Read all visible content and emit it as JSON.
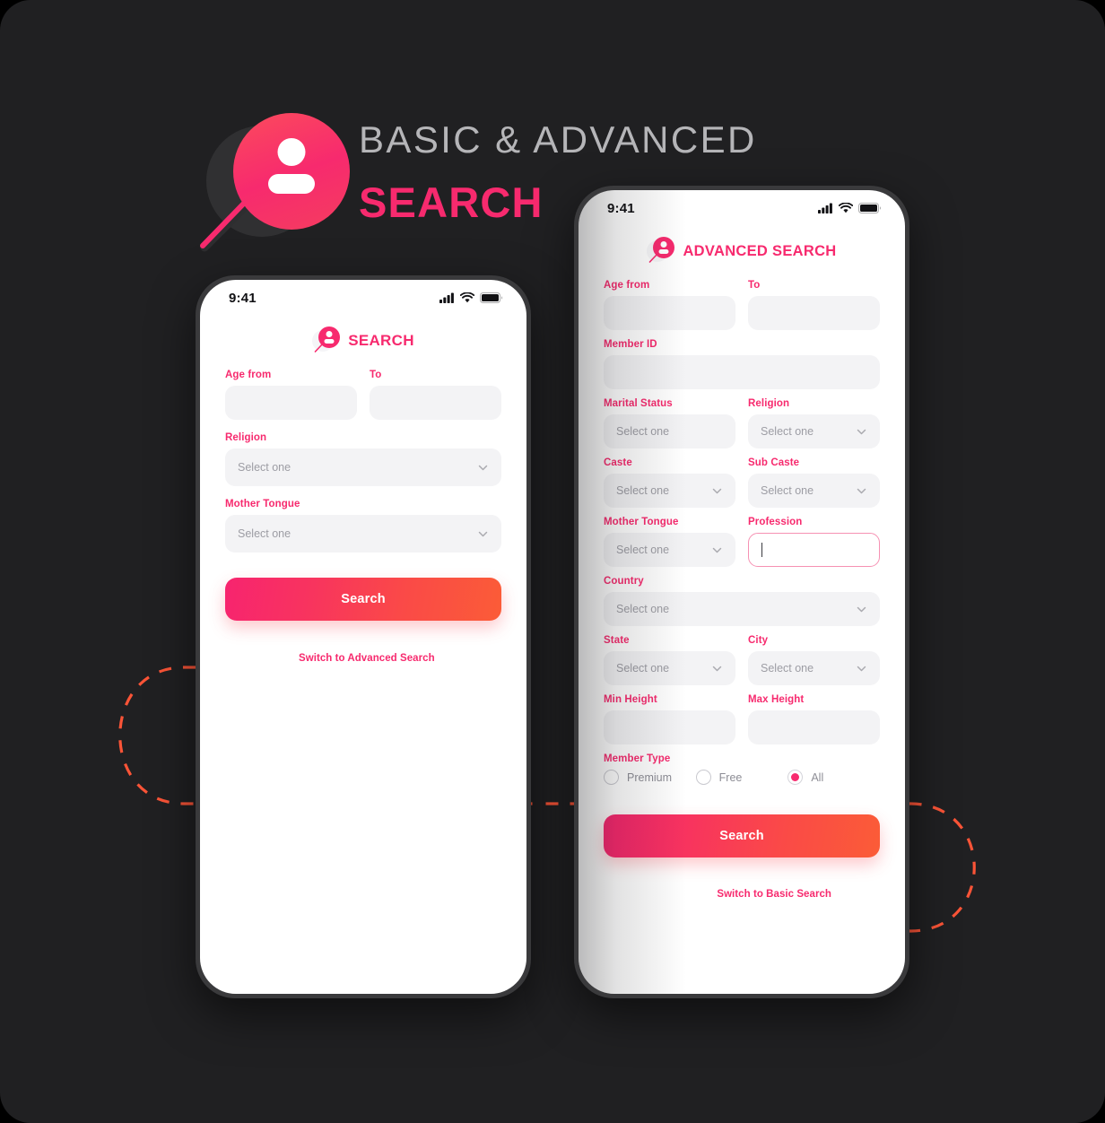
{
  "poster": {
    "title_line1": "BASIC & ADVANCED",
    "title_line2": "SEARCH",
    "background_color": "#202022",
    "accent_color": "#f72a6e",
    "accent_orange": "#fb5c37",
    "logo_icon": "person-magnifier-icon"
  },
  "basic_phone": {
    "status": {
      "time": "9:41",
      "signal_icon": "cellular-signal-icon",
      "wifi_icon": "wifi-icon",
      "battery_icon": "battery-icon"
    },
    "app_title": "SEARCH",
    "app_logo_icon": "person-magnifier-icon",
    "fields": [
      {
        "label": "Age from",
        "type": "text",
        "value": "",
        "placeholder": ""
      },
      {
        "label": "To",
        "type": "text",
        "value": "",
        "placeholder": ""
      },
      {
        "label": "Religion",
        "type": "select",
        "value": "Select one",
        "placeholder": "Select one"
      },
      {
        "label": "Mother Tongue",
        "type": "select",
        "value": "Select one",
        "placeholder": "Select one"
      }
    ],
    "search_button": "Search",
    "switch_link": "Switch to Advanced Search"
  },
  "advanced_phone": {
    "status": {
      "time": "9:41",
      "signal_icon": "cellular-signal-icon",
      "wifi_icon": "wifi-icon",
      "battery_icon": "battery-icon"
    },
    "app_title": "ADVANCED SEARCH",
    "app_logo_icon": "person-magnifier-icon",
    "fields": [
      {
        "label": "Age from",
        "type": "text",
        "value": "",
        "placeholder": ""
      },
      {
        "label": "To",
        "type": "text",
        "value": "",
        "placeholder": ""
      },
      {
        "label": "Member ID",
        "type": "text",
        "value": "",
        "placeholder": ""
      },
      {
        "label": "Marital Status",
        "type": "select",
        "value": "Select one",
        "placeholder": "Select one"
      },
      {
        "label": "Religion",
        "type": "select",
        "value": "Select one",
        "placeholder": "Select one"
      },
      {
        "label": "Caste",
        "type": "select",
        "value": "Select one",
        "placeholder": "Select one"
      },
      {
        "label": "Sub Caste",
        "type": "select",
        "value": "Select one",
        "placeholder": "Select one"
      },
      {
        "label": "Mother Tongue",
        "type": "select",
        "value": "Select one",
        "placeholder": "Select one"
      },
      {
        "label": "Profession",
        "type": "text",
        "value": "",
        "placeholder": "",
        "focused": true
      },
      {
        "label": "Country",
        "type": "select",
        "value": "Select one",
        "placeholder": "Select one"
      },
      {
        "label": "State",
        "type": "select",
        "value": "Select one",
        "placeholder": "Select one"
      },
      {
        "label": "City",
        "type": "select",
        "value": "Select one",
        "placeholder": "Select one"
      },
      {
        "label": "Min Height",
        "type": "text",
        "value": "",
        "placeholder": ""
      },
      {
        "label": "Max Height",
        "type": "text",
        "value": "",
        "placeholder": ""
      }
    ],
    "member_type": {
      "label": "Member Type",
      "options": [
        {
          "label": "Premium",
          "selected": false
        },
        {
          "label": "Free",
          "selected": false
        },
        {
          "label": "All",
          "selected": true
        }
      ]
    },
    "search_button": "Search",
    "switch_link": "Switch to Basic Search"
  }
}
